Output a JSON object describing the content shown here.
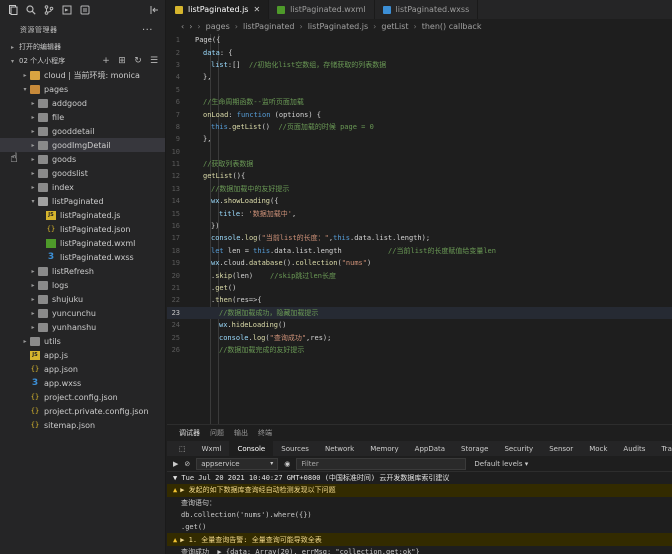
{
  "sidebar": {
    "explorer_title": "资源管理器",
    "open_editors_label": "打开的编辑器",
    "project_label": "02 个人小程序",
    "tree": [
      {
        "label": "cloud | 当前环境: monica",
        "depth": 1,
        "kind": "cloud",
        "chev": "▸"
      },
      {
        "label": "pages",
        "depth": 1,
        "kind": "pages",
        "chev": "▾"
      },
      {
        "label": "addgood",
        "depth": 2,
        "kind": "folder",
        "chev": "▸"
      },
      {
        "label": "file",
        "depth": 2,
        "kind": "folder",
        "chev": "▸"
      },
      {
        "label": "gooddetail",
        "depth": 2,
        "kind": "folder",
        "chev": "▸"
      },
      {
        "label": "goodImgDetail",
        "depth": 2,
        "kind": "folder",
        "chev": "▸",
        "selected": true
      },
      {
        "label": "goods",
        "depth": 2,
        "kind": "folder",
        "chev": "▸"
      },
      {
        "label": "goodslist",
        "depth": 2,
        "kind": "folder",
        "chev": "▸"
      },
      {
        "label": "index",
        "depth": 2,
        "kind": "folder",
        "chev": "▸"
      },
      {
        "label": "listPaginated",
        "depth": 2,
        "kind": "folder-open",
        "chev": "▾"
      },
      {
        "label": "listPaginated.js",
        "depth": 3,
        "kind": "js",
        "chev": ""
      },
      {
        "label": "listPaginated.json",
        "depth": 3,
        "kind": "json",
        "chev": ""
      },
      {
        "label": "listPaginated.wxml",
        "depth": 3,
        "kind": "wxml",
        "chev": ""
      },
      {
        "label": "listPaginated.wxss",
        "depth": 3,
        "kind": "wxss",
        "chev": ""
      },
      {
        "label": "listRefresh",
        "depth": 2,
        "kind": "folder",
        "chev": "▸"
      },
      {
        "label": "logs",
        "depth": 2,
        "kind": "folder",
        "chev": "▸"
      },
      {
        "label": "shujuku",
        "depth": 2,
        "kind": "folder",
        "chev": "▸"
      },
      {
        "label": "yuncunchu",
        "depth": 2,
        "kind": "folder",
        "chev": "▸"
      },
      {
        "label": "yunhanshu",
        "depth": 2,
        "kind": "folder",
        "chev": "▸"
      },
      {
        "label": "utils",
        "depth": 1,
        "kind": "folder",
        "chev": "▸"
      },
      {
        "label": "app.js",
        "depth": 1,
        "kind": "js",
        "chev": ""
      },
      {
        "label": "app.json",
        "depth": 1,
        "kind": "json",
        "chev": ""
      },
      {
        "label": "app.wxss",
        "depth": 1,
        "kind": "wxss",
        "chev": ""
      },
      {
        "label": "project.config.json",
        "depth": 1,
        "kind": "json",
        "chev": ""
      },
      {
        "label": "project.private.config.json",
        "depth": 1,
        "kind": "json",
        "chev": ""
      },
      {
        "label": "sitemap.json",
        "depth": 1,
        "kind": "json",
        "chev": ""
      }
    ]
  },
  "editor": {
    "tabs": [
      {
        "label": "listPaginated.js",
        "kind": "js",
        "active": true
      },
      {
        "label": "listPaginated.wxml",
        "kind": "wxml",
        "active": false
      },
      {
        "label": "listPaginated.wxss",
        "kind": "wxss",
        "active": false
      }
    ],
    "breadcrumb": [
      "pages",
      "listPaginated",
      "listPaginated.js",
      "getList",
      "then() callback"
    ],
    "current_line": 23,
    "lines": [
      {
        "n": 1,
        "indent": 0,
        "seg": [
          [
            "Page({",
            "#d4d4d4"
          ]
        ]
      },
      {
        "n": 2,
        "indent": 1,
        "seg": [
          [
            "data",
            "#9cdcfe"
          ],
          [
            ": {",
            "#d4d4d4"
          ]
        ]
      },
      {
        "n": 3,
        "indent": 2,
        "seg": [
          [
            "list",
            "#9cdcfe"
          ],
          [
            ":[]  ",
            "#d4d4d4"
          ],
          [
            "//初始化list空数组，存储获取的列表数据",
            "#6a9955"
          ]
        ]
      },
      {
        "n": 4,
        "indent": 1,
        "seg": [
          [
            "},",
            "#d4d4d4"
          ]
        ]
      },
      {
        "n": 5,
        "indent": 0,
        "seg": []
      },
      {
        "n": 6,
        "indent": 1,
        "seg": [
          [
            "//生命周期函数--监听页面加载",
            "#6a9955"
          ]
        ]
      },
      {
        "n": 7,
        "indent": 1,
        "seg": [
          [
            "onLoad",
            "#dcdcaa"
          ],
          [
            ": ",
            "#d4d4d4"
          ],
          [
            "function",
            "#569cd6"
          ],
          [
            " (options) {",
            "#d4d4d4"
          ]
        ]
      },
      {
        "n": 8,
        "indent": 2,
        "seg": [
          [
            "this",
            "#569cd6"
          ],
          [
            ".",
            "#d4d4d4"
          ],
          [
            "getList",
            "#dcdcaa"
          ],
          [
            "()  ",
            "#d4d4d4"
          ],
          [
            "//页面加载的时候 page = 0",
            "#6a9955"
          ]
        ]
      },
      {
        "n": 9,
        "indent": 1,
        "seg": [
          [
            "},",
            "#d4d4d4"
          ]
        ]
      },
      {
        "n": 10,
        "indent": 0,
        "seg": []
      },
      {
        "n": 11,
        "indent": 1,
        "seg": [
          [
            "//获取列表数据",
            "#6a9955"
          ]
        ]
      },
      {
        "n": 12,
        "indent": 1,
        "seg": [
          [
            "getList",
            "#dcdcaa"
          ],
          [
            "(){",
            "#d4d4d4"
          ]
        ]
      },
      {
        "n": 13,
        "indent": 2,
        "seg": [
          [
            "//数据加载中的友好提示",
            "#6a9955"
          ]
        ]
      },
      {
        "n": 14,
        "indent": 2,
        "seg": [
          [
            "wx",
            "#9cdcfe"
          ],
          [
            ".",
            "#d4d4d4"
          ],
          [
            "showLoading",
            "#dcdcaa"
          ],
          [
            "({",
            "#d4d4d4"
          ]
        ]
      },
      {
        "n": 15,
        "indent": 3,
        "seg": [
          [
            "title",
            "#9cdcfe"
          ],
          [
            ": ",
            "#d4d4d4"
          ],
          [
            "'数据加载中'",
            "#ce9178"
          ],
          [
            ",",
            "#d4d4d4"
          ]
        ]
      },
      {
        "n": 16,
        "indent": 2,
        "seg": [
          [
            "})",
            "#d4d4d4"
          ]
        ]
      },
      {
        "n": 17,
        "indent": 2,
        "seg": [
          [
            "console",
            "#9cdcfe"
          ],
          [
            ".",
            "#d4d4d4"
          ],
          [
            "log",
            "#dcdcaa"
          ],
          [
            "(",
            "#d4d4d4"
          ],
          [
            "\"当前list的长度：\"",
            "#ce9178"
          ],
          [
            ",",
            "#d4d4d4"
          ],
          [
            "this",
            "#569cd6"
          ],
          [
            ".data.list.length);",
            "#d4d4d4"
          ]
        ]
      },
      {
        "n": 18,
        "indent": 2,
        "seg": [
          [
            "let",
            "#569cd6"
          ],
          [
            " len = ",
            "#d4d4d4"
          ],
          [
            "this",
            "#569cd6"
          ],
          [
            ".data.list.length           ",
            "#d4d4d4"
          ],
          [
            "//当前list的长度赋值给变量len",
            "#6a9955"
          ]
        ]
      },
      {
        "n": 19,
        "indent": 2,
        "seg": [
          [
            "wx",
            "#9cdcfe"
          ],
          [
            ".cloud.",
            "#d4d4d4"
          ],
          [
            "database",
            "#dcdcaa"
          ],
          [
            "().",
            "#d4d4d4"
          ],
          [
            "collection",
            "#dcdcaa"
          ],
          [
            "(",
            "#d4d4d4"
          ],
          [
            "\"nums\"",
            "#ce9178"
          ],
          [
            ")",
            "#d4d4d4"
          ]
        ]
      },
      {
        "n": 20,
        "indent": 2,
        "seg": [
          [
            ".",
            "#d4d4d4"
          ],
          [
            "skip",
            "#dcdcaa"
          ],
          [
            "(len)    ",
            "#d4d4d4"
          ],
          [
            "//skip跳过len长度",
            "#6a9955"
          ]
        ]
      },
      {
        "n": 21,
        "indent": 2,
        "seg": [
          [
            ".",
            "#d4d4d4"
          ],
          [
            "get",
            "#dcdcaa"
          ],
          [
            "()",
            "#d4d4d4"
          ]
        ]
      },
      {
        "n": 22,
        "indent": 2,
        "seg": [
          [
            ".",
            "#d4d4d4"
          ],
          [
            "then",
            "#dcdcaa"
          ],
          [
            "(res=>{",
            "#d4d4d4"
          ]
        ]
      },
      {
        "n": 23,
        "indent": 3,
        "seg": [
          [
            "//数据加载成功，隐藏加载提示",
            "#6a9955"
          ]
        ]
      },
      {
        "n": 24,
        "indent": 3,
        "seg": [
          [
            "wx",
            "#9cdcfe"
          ],
          [
            ".",
            "#d4d4d4"
          ],
          [
            "hideLoading",
            "#dcdcaa"
          ],
          [
            "()",
            "#d4d4d4"
          ]
        ]
      },
      {
        "n": 25,
        "indent": 3,
        "seg": [
          [
            "console",
            "#9cdcfe"
          ],
          [
            ".",
            "#d4d4d4"
          ],
          [
            "log",
            "#dcdcaa"
          ],
          [
            "(",
            "#d4d4d4"
          ],
          [
            "\"查询成功\"",
            "#ce9178"
          ],
          [
            ",res);",
            "#d4d4d4"
          ]
        ]
      },
      {
        "n": 26,
        "indent": 3,
        "seg": [
          [
            "//数据加载完成的友好提示",
            "#6a9955"
          ]
        ]
      }
    ]
  },
  "panel": {
    "tabs": [
      "调试器",
      "问题",
      "输出",
      "终端"
    ],
    "devtools_tabs": [
      "Wxml",
      "Console",
      "Sources",
      "Network",
      "Memory",
      "AppData",
      "Storage",
      "Security",
      "Sensor",
      "Mock",
      "Audits",
      "Trace"
    ],
    "active_devtools_tab": "Console",
    "context_select": "appservice",
    "filter_placeholder": "Filter",
    "levels_label": "Default levels ▾",
    "console_lines": [
      {
        "text": "▼ Tue Jul 20 2021 10:40:27 GMT+0800 (中国标准时间) 云开发数据库索引建议",
        "kind": "group"
      },
      {
        "text": "▶ 发起的如下数据库查询经自动检测发现以下问题",
        "kind": "warn"
      },
      {
        "text": "查询语句：",
        "kind": "plain"
      },
      {
        "text": "db.collection('nums').where({})",
        "kind": "plain"
      },
      {
        "text": ".get()",
        "kind": "plain"
      },
      {
        "text": "▶ 1. 全量查询告警: 全量查询可能导致全表",
        "kind": "warn"
      },
      {
        "text": "查询成功  ▶ {data: Array(20), errMsg: \"collection.get:ok\"}",
        "kind": "plain"
      }
    ]
  },
  "colors": {
    "sidebar_bg": "#252526",
    "editor_bg": "#1e1e1e",
    "warn_bg": "#332b00",
    "accent_js": "#d6b52d",
    "accent_wxml": "#4e9a2a",
    "accent_wxss": "#3c8fd6"
  }
}
